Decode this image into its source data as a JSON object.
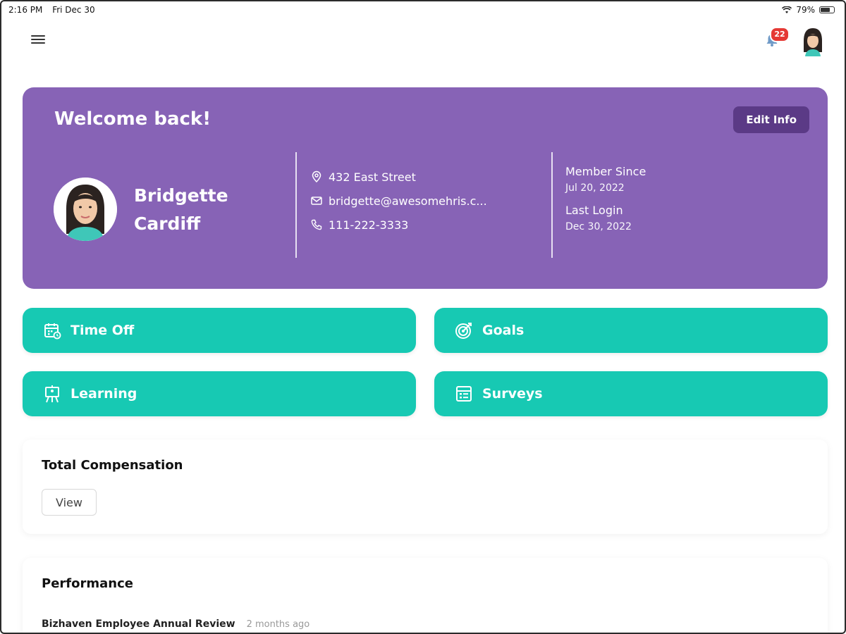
{
  "status_bar": {
    "time": "2:16 PM",
    "date": "Fri Dec 30",
    "battery": "79%",
    "battery_level": 0.79
  },
  "header": {
    "menu_icon": "hamburger-menu-icon",
    "notification_count": "22",
    "bell_icon": "bell-icon"
  },
  "welcome": {
    "title": "Welcome back!",
    "edit_label": "Edit Info",
    "first_name": "Bridgette",
    "last_name": "Cardiff",
    "address": "432 East Street",
    "email": "bridgette@awesomehris.c...",
    "phone": "111-222-3333",
    "member_since_label": "Member Since",
    "member_since_value": "Jul 20, 2022",
    "last_login_label": "Last Login",
    "last_login_value": "Dec 30, 2022"
  },
  "tiles": [
    {
      "label": "Time Off",
      "icon": "calendar-icon"
    },
    {
      "label": "Goals",
      "icon": "target-icon"
    },
    {
      "label": "Learning",
      "icon": "easel-icon"
    },
    {
      "label": "Surveys",
      "icon": "survey-list-icon"
    }
  ],
  "compensation": {
    "title": "Total Compensation",
    "view_label": "View"
  },
  "performance": {
    "title": "Performance",
    "review_name": "Bizhaven Employee Annual Review",
    "review_time": "2 months ago"
  },
  "colors": {
    "purple": "#8763b6",
    "dark_purple": "#5b3a86",
    "teal": "#17c9b3",
    "badge": "#e53935"
  }
}
